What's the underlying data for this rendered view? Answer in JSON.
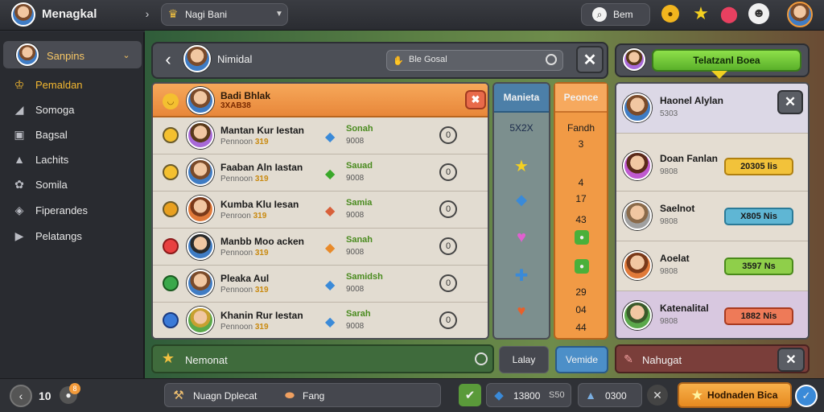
{
  "app": {
    "title": "Menagkal",
    "selector_label": "Nagi Bani",
    "search_label": "Bem"
  },
  "sidebar": {
    "items": [
      {
        "label": "Sanpins",
        "icon": "person-icon"
      },
      {
        "label": "Pemaldan",
        "icon": "trophy-icon"
      },
      {
        "label": "Somoga",
        "icon": "chart-icon"
      },
      {
        "label": "Bagsal",
        "icon": "bag-icon"
      },
      {
        "label": "Lachits",
        "icon": "stats-icon"
      },
      {
        "label": "Somila",
        "icon": "gear-icon"
      },
      {
        "label": "Fiperandes",
        "icon": "shield-icon"
      },
      {
        "label": "Pelatangs",
        "icon": "flag-icon"
      }
    ]
  },
  "main": {
    "title": "Nimidal",
    "search_placeholder": "Ble Gosal",
    "header": {
      "name": "Badi Bhlak",
      "sub": "3XAB38"
    },
    "rows": [
      {
        "name": "Mantan Kur Iestan",
        "sub_prefix": "Pennoon",
        "sub_value": "319",
        "gift_title": "Sonah",
        "gift_sub": "9008",
        "count": "0"
      },
      {
        "name": "Faaban Aln Iastan",
        "sub_prefix": "Pennoon",
        "sub_value": "319",
        "gift_title": "Sauad",
        "gift_sub": "9008",
        "count": "0"
      },
      {
        "name": "Kumba Klu Iesan",
        "sub_prefix": "Penroon",
        "sub_value": "319",
        "gift_title": "Samia",
        "gift_sub": "9008",
        "count": "0"
      },
      {
        "name": "Manbb Moo acken",
        "sub_prefix": "Pennoon",
        "sub_value": "319",
        "gift_title": "Sanah",
        "gift_sub": "9008",
        "count": "0"
      },
      {
        "name": "Pleaka Aul",
        "sub_prefix": "Pennoon",
        "sub_value": "319",
        "gift_title": "Samidsh",
        "gift_sub": "9008",
        "count": "0"
      },
      {
        "name": "Khanin Rur Iestan",
        "sub_prefix": "Pennoon",
        "sub_value": "319",
        "gift_title": "Sarah",
        "gift_sub": "9008",
        "count": "0"
      }
    ],
    "col1_header": "Manieta",
    "col1_values": [
      "5X2X",
      "",
      "",
      "",
      "",
      ""
    ],
    "col2_header": "Peonce",
    "col2_values": [
      "Fandh",
      "3",
      "4",
      "17",
      "43",
      "29",
      "04",
      "44"
    ],
    "footer_label": "Nemonat",
    "footer_btn1": "Lalay",
    "footer_btn2": "Vemide"
  },
  "right": {
    "tab_label": "Telatzanl Boea",
    "top": {
      "name": "Haonel Alylan",
      "sub": "5303"
    },
    "rows": [
      {
        "name": "Doan Fanlan",
        "sub": "9808",
        "badge": "20305 lis",
        "color": "#f2c23a"
      },
      {
        "name": "Saelnot",
        "sub": "9808",
        "badge": "X805 Nis",
        "color": "#5fb6d4"
      },
      {
        "name": "Aoelat",
        "sub": "9808",
        "badge": "3597 Ns",
        "color": "#8fcf4a"
      },
      {
        "name": "Katenalital",
        "sub": "9808",
        "badge": "1882 Nis",
        "color": "#ee7a58"
      }
    ],
    "footer_label": "Nahugat"
  },
  "bottom": {
    "count": "10",
    "badge": "8",
    "item1": "Nuagn Dplecat",
    "item2": "Fang",
    "coins": "13800",
    "coins_sub": "S50",
    "gems": "0300",
    "cta": "Hodnaden Bica"
  }
}
